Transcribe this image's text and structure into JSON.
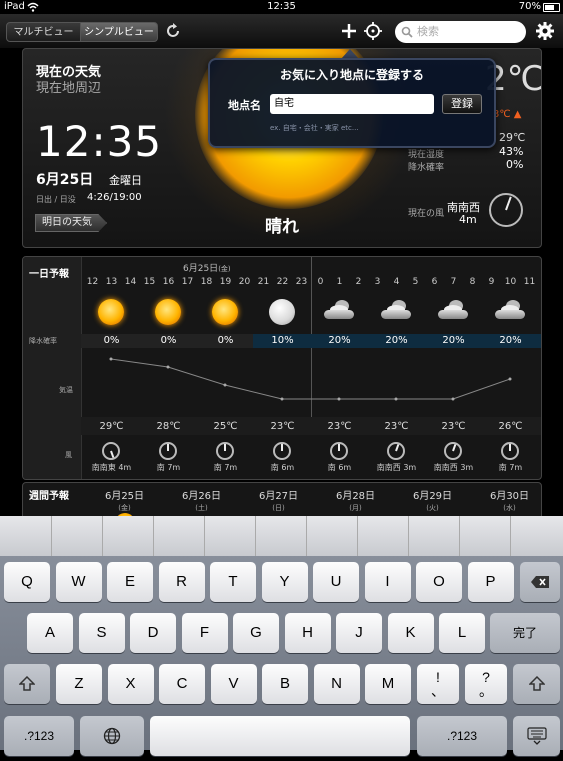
{
  "status_bar": {
    "carrier": "iPad",
    "time": "12:35",
    "battery": "70%"
  },
  "toolbar": {
    "segment_multi": "マルチビュー",
    "segment_simple": "シンプルビュー",
    "refresh_icon": "refresh-icon",
    "add_icon": "plus-icon",
    "locate_icon": "crosshair-icon",
    "search_placeholder": "検索",
    "settings_icon": "gear-icon"
  },
  "current": {
    "title": "現在の天気",
    "location": "現在地周辺",
    "time": "12:35",
    "date": "6月25日",
    "weekday": "金曜日",
    "sun_label": "日出 / 日没",
    "sun_times": "4:26/19:00",
    "tomorrow_button": "明日の天気",
    "condition": "晴れ",
    "temp_partial": "2℃",
    "max_temp_partial": "3℃",
    "max_arrow": "▲",
    "low_temp": "29℃",
    "humidity_label": "現在湿度",
    "humidity": "43%",
    "precip_label": "降水確率",
    "precip": "0%",
    "wind_label": "現在の風",
    "wind_dir": "南南西",
    "wind_speed": "4m"
  },
  "popover": {
    "title": "お気に入り地点に登録する",
    "field_label": "地点名",
    "field_value": "自宅",
    "register_button": "登録",
    "hint": "ex. 自宅・会社・実家 etc..."
  },
  "hourly": {
    "title": "一日予報",
    "date_label": "6月25日",
    "date_weekday": "(金)",
    "hours": [
      "12",
      "13",
      "14",
      "15",
      "16",
      "17",
      "18",
      "19",
      "20",
      "21",
      "22",
      "23",
      "0",
      "1",
      "2",
      "3",
      "4",
      "5",
      "6",
      "7",
      "8",
      "9",
      "10",
      "11"
    ],
    "precip_label": "降水確率",
    "temp_label": "気温",
    "wind_label": "風",
    "slots": [
      {
        "icon": "sun-icon",
        "precip": "0%",
        "temp": "29℃",
        "wind": "南南東 4m"
      },
      {
        "icon": "sun-icon",
        "precip": "0%",
        "temp": "28℃",
        "wind": "南 7m"
      },
      {
        "icon": "sun-icon",
        "precip": "0%",
        "temp": "25℃",
        "wind": "南 7m"
      },
      {
        "icon": "moon-icon",
        "precip": "10%",
        "temp": "23℃",
        "wind": "南 6m"
      },
      {
        "icon": "cloud-icon",
        "precip": "20%",
        "temp": "23℃",
        "wind": "南 6m"
      },
      {
        "icon": "cloud-icon",
        "precip": "20%",
        "temp": "23℃",
        "wind": "南南西 3m"
      },
      {
        "icon": "cloud-icon",
        "precip": "20%",
        "temp": "23℃",
        "wind": "南南西 3m"
      },
      {
        "icon": "cloud-icon",
        "precip": "20%",
        "temp": "26℃",
        "wind": "南 7m"
      }
    ]
  },
  "weekly": {
    "title": "週間予報",
    "days": [
      {
        "date": "6月25日",
        "wd": "(金)"
      },
      {
        "date": "6月26日",
        "wd": "(土)"
      },
      {
        "date": "6月27日",
        "wd": "(日)"
      },
      {
        "date": "6月28日",
        "wd": "(月)"
      },
      {
        "date": "6月29日",
        "wd": "(火)"
      },
      {
        "date": "6月30日",
        "wd": "(水)"
      }
    ]
  },
  "keyboard": {
    "row1": [
      "Q",
      "W",
      "E",
      "R",
      "T",
      "Y",
      "U",
      "I",
      "O",
      "P"
    ],
    "row2": [
      "A",
      "S",
      "D",
      "F",
      "G",
      "H",
      "J",
      "K",
      "L"
    ],
    "row3": [
      "Z",
      "X",
      "C",
      "V",
      "B",
      "N",
      "M"
    ],
    "done": "完了",
    "exclaim_top": "!",
    "exclaim_bottom": "、",
    "question_top": "?",
    "question_bottom": "。",
    "num_label": ".?123",
    "backspace_icon": "backspace-icon",
    "shift_icon": "shift-icon",
    "globe_icon": "globe-icon",
    "hide_icon": "keyboard-hide-icon"
  }
}
